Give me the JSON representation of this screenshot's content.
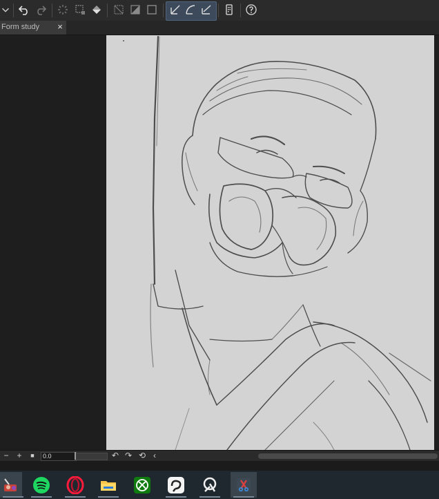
{
  "document": {
    "tab_title": "Form study",
    "close_symbol": "×"
  },
  "toolbar": {
    "buttons": [
      {
        "name": "menu-chevron-icon"
      },
      {
        "name": "undo-icon"
      },
      {
        "name": "redo-icon"
      },
      {
        "name": "loading-spinner-icon"
      },
      {
        "name": "transform-selection-icon"
      },
      {
        "name": "fill-bucket-icon"
      },
      {
        "name": "deselect-icon"
      },
      {
        "name": "invert-selection-icon"
      },
      {
        "name": "select-all-icon"
      },
      {
        "name": "ruler-line-icon"
      },
      {
        "name": "ruler-curve-icon"
      },
      {
        "name": "ruler-snap-icon"
      },
      {
        "name": "device-panel-icon"
      },
      {
        "name": "help-icon"
      }
    ]
  },
  "statusbar": {
    "zoom_out": "−",
    "zoom_in": "+",
    "stop": "■",
    "rotation_value": "0.0",
    "rotate_left": "↶",
    "rotate_right": "↷",
    "reset": "⟲",
    "collapse": "‹"
  },
  "taskbar": {
    "apps": [
      {
        "name": "paint-app-icon",
        "active": true
      },
      {
        "name": "spotify-icon",
        "active": false
      },
      {
        "name": "opera-icon",
        "active": false
      },
      {
        "name": "file-explorer-icon",
        "active": false
      },
      {
        "name": "xbox-icon",
        "active": false
      },
      {
        "name": "clip-studio-icon",
        "active": false
      },
      {
        "name": "paint-brush-app-icon",
        "active": false
      },
      {
        "name": "snipping-tool-icon",
        "active": true
      }
    ]
  },
  "colors": {
    "canvas": "#d3d3d3",
    "toolbar": "#2b2b2b",
    "taskbar": "#20282f",
    "active_tool": "#3c4a5c",
    "sketch_line": "#4a4a4a"
  }
}
